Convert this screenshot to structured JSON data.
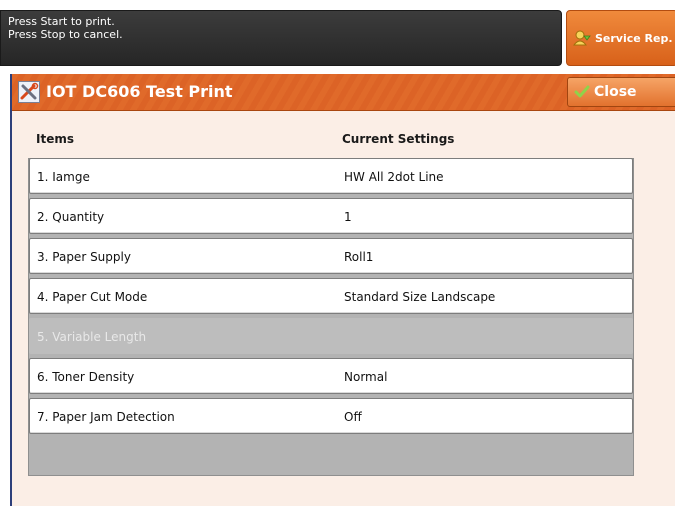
{
  "message": {
    "line1": "Press Start to print.",
    "line2": "Press Stop to cancel."
  },
  "service_button": {
    "label": "Service Rep.",
    "icon": "service-rep-icon"
  },
  "dialog": {
    "title": "IOT DC606 Test Print",
    "title_icon": "tools-icon",
    "close_label": "Close",
    "close_icon": "check-icon",
    "headers": {
      "items": "Items",
      "settings": "Current Settings"
    },
    "rows": [
      {
        "item": "1. Iamge",
        "setting": "HW All 2dot Line",
        "enabled": true
      },
      {
        "item": "2. Quantity",
        "setting": "1",
        "enabled": true
      },
      {
        "item": "3. Paper Supply",
        "setting": "Roll1",
        "enabled": true
      },
      {
        "item": "4. Paper Cut Mode",
        "setting": "Standard Size Landscape",
        "enabled": true
      },
      {
        "item": "5. Variable Length",
        "setting": "",
        "enabled": false
      },
      {
        "item": "6. Toner Density",
        "setting": "Normal",
        "enabled": true
      },
      {
        "item": "7. Paper Jam Detection",
        "setting": "Off",
        "enabled": true
      }
    ]
  },
  "colors": {
    "title_orange": "#e06a2a",
    "dialog_bg": "#fbeee6",
    "message_bg": "#2f2f2f",
    "disabled_row": "#bdbdbd"
  }
}
